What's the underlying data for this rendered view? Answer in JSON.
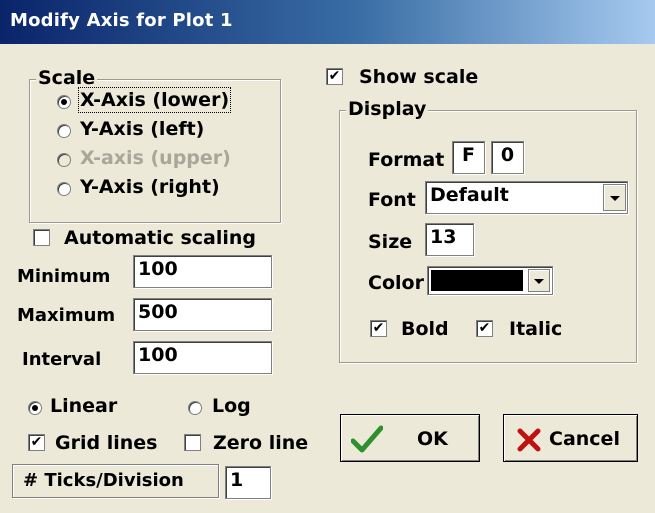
{
  "title": "Modify Axis for Plot 1",
  "scale_group": {
    "label": "Scale",
    "options": [
      {
        "label": "X-Axis (lower)",
        "selected": true,
        "enabled": true
      },
      {
        "label": "Y-Axis (left)",
        "selected": false,
        "enabled": true
      },
      {
        "label": "X-axis (upper)",
        "selected": false,
        "enabled": false
      },
      {
        "label": "Y-Axis (right)",
        "selected": false,
        "enabled": true
      }
    ]
  },
  "automatic_scaling": {
    "label": "Automatic scaling",
    "checked": false
  },
  "minimum": {
    "label": "Minimum",
    "value": "100"
  },
  "maximum": {
    "label": "Maximum",
    "value": "500"
  },
  "interval": {
    "label": "Interval",
    "value": "100"
  },
  "scale_type": {
    "linear": {
      "label": "Linear",
      "selected": true
    },
    "log": {
      "label": "Log",
      "selected": false
    }
  },
  "grid_lines": {
    "label": "Grid lines",
    "checked": true
  },
  "zero_line": {
    "label": "Zero line",
    "checked": false
  },
  "ticks": {
    "label": "# Ticks/Division",
    "value": "1"
  },
  "show_scale": {
    "label": "Show scale",
    "checked": true
  },
  "display_group": {
    "label": "Display",
    "format": {
      "label": "Format",
      "value1": "F",
      "value2": "0"
    },
    "font": {
      "label": "Font",
      "value": "Default"
    },
    "size": {
      "label": "Size",
      "value": "13"
    },
    "color": {
      "label": "Color",
      "value": "#000000"
    },
    "bold": {
      "label": "Bold",
      "checked": true
    },
    "italic": {
      "label": "Italic",
      "checked": true
    }
  },
  "ok_button": {
    "label": "OK",
    "icon": "checkmark-icon",
    "icon_color": "#2f8f2f"
  },
  "cancel_button": {
    "label": "Cancel",
    "icon": "x-icon",
    "icon_color": "#c01010"
  },
  "check_glyph": "✔"
}
